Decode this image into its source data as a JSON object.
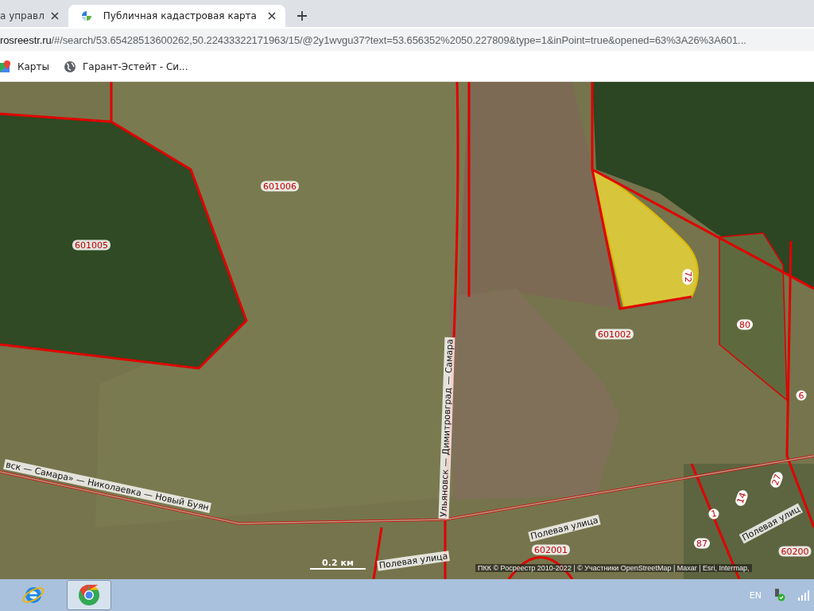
{
  "browser": {
    "tabs": [
      {
        "title": "а управл",
        "selected": false
      },
      {
        "title": "Публичная кадастровая карта",
        "selected": true
      }
    ],
    "address": {
      "domain": "rosreestr.ru",
      "path": "/#/search/53.65428513600262,50.22433322171963/15/@2y1wvgu37?text=53.656352%2050.227809&type=1&inPoint=true&opened=63%3A26%3A601..."
    },
    "bookmarks": [
      {
        "kind": "maps",
        "label": "Карты"
      },
      {
        "kind": "globe",
        "label": "Гарант-Эстейт - Си..."
      }
    ]
  },
  "map": {
    "labels": [
      {
        "kind": "block",
        "text": "601006"
      },
      {
        "kind": "block",
        "text": "601005"
      },
      {
        "kind": "block",
        "text": "601002"
      },
      {
        "kind": "block",
        "text": "602001"
      },
      {
        "kind": "block",
        "text": "60200"
      },
      {
        "kind": "parcel",
        "text": "72"
      },
      {
        "kind": "parcel",
        "text": "80"
      },
      {
        "kind": "parcel",
        "text": "6"
      },
      {
        "kind": "parcel",
        "text": "14"
      },
      {
        "kind": "parcel",
        "text": "1"
      },
      {
        "kind": "parcel",
        "text": "87"
      },
      {
        "kind": "parcel",
        "text": "27"
      },
      {
        "kind": "road",
        "text": "Ульяновск — Димитровград — Самара"
      },
      {
        "kind": "road",
        "text": "вск — Самара» — Николаевка — Новый Буян"
      },
      {
        "kind": "road",
        "text": "Полевая улица"
      },
      {
        "kind": "road",
        "text": "Полевая улица"
      },
      {
        "kind": "road",
        "text": "Полевая улиц"
      }
    ],
    "scale": "0.2 км",
    "attribution": "ПКК © Росреестр 2010-2022 | © Участники OpenStreetMap | Maxar | Esri, Intermap,"
  },
  "taskbar": {
    "apps": [
      {
        "kind": "ie",
        "selected": false
      },
      {
        "kind": "chrome",
        "selected": true
      }
    ],
    "language": "EN"
  }
}
